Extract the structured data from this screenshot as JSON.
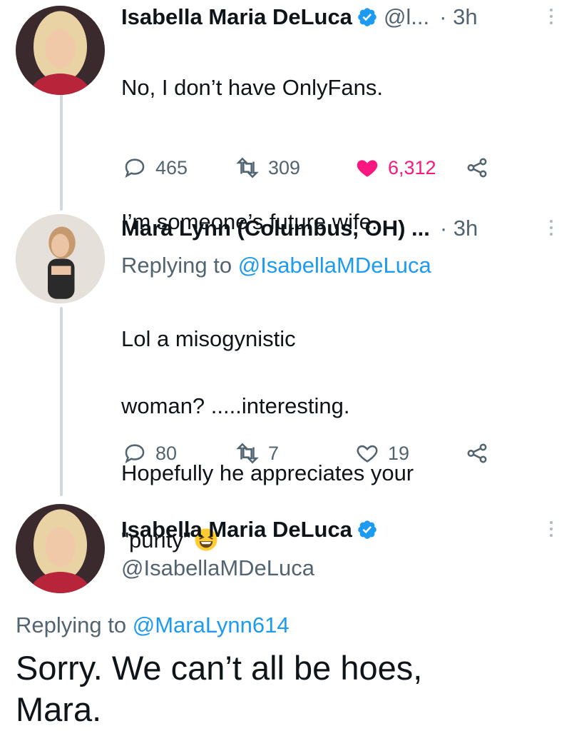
{
  "tweet1": {
    "name": "Isabella Maria DeLuca",
    "handle": "@l...",
    "time": "· 3h",
    "lines": [
      "No, I don’t have OnlyFans.",
      "",
      "I’m someone’s future wife."
    ],
    "replies": "465",
    "retweets": "309",
    "likes": "6,312",
    "verified_icon": "verified-badge-icon",
    "accent": "#1d9bf0",
    "like_color": "#f91880"
  },
  "tweet2": {
    "name": "Mara Lynn (Columbus, OH) ...",
    "time": "· 3h",
    "replying_prefix": "Replying to",
    "replying_mention": "@IsabellaMDeLuca",
    "lines": [
      "Lol a misogynistic",
      "woman? .....interesting.",
      "Hopefully he appreciates your",
      "\"purity\""
    ],
    "emoji": "grinning-squinting-face-emoji",
    "replies": "80",
    "retweets": "7",
    "likes": "19"
  },
  "tweet3": {
    "name": "Isabella Maria DeLuca",
    "handle": "@IsabellaMDeLuca",
    "replying_prefix": "Replying to",
    "replying_mention": "@MaraLynn614",
    "line1": "Sorry. We can’t all be hoes,",
    "line2": "Mara."
  }
}
